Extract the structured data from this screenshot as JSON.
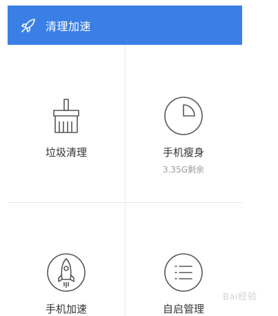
{
  "header": {
    "title": "清理加速",
    "icon": "rocket-icon",
    "background": "#3a7fe6"
  },
  "tiles": [
    {
      "label": "垃圾清理",
      "sub": "",
      "icon": "broom-icon"
    },
    {
      "label": "手机瘦身",
      "sub": "3.35G剩余",
      "icon": "pie-chart-icon"
    },
    {
      "label": "手机加速",
      "sub": "",
      "icon": "rocket-icon"
    },
    {
      "label": "自启管理",
      "sub": "",
      "icon": "list-icon"
    }
  ],
  "watermark": "Bai经验"
}
